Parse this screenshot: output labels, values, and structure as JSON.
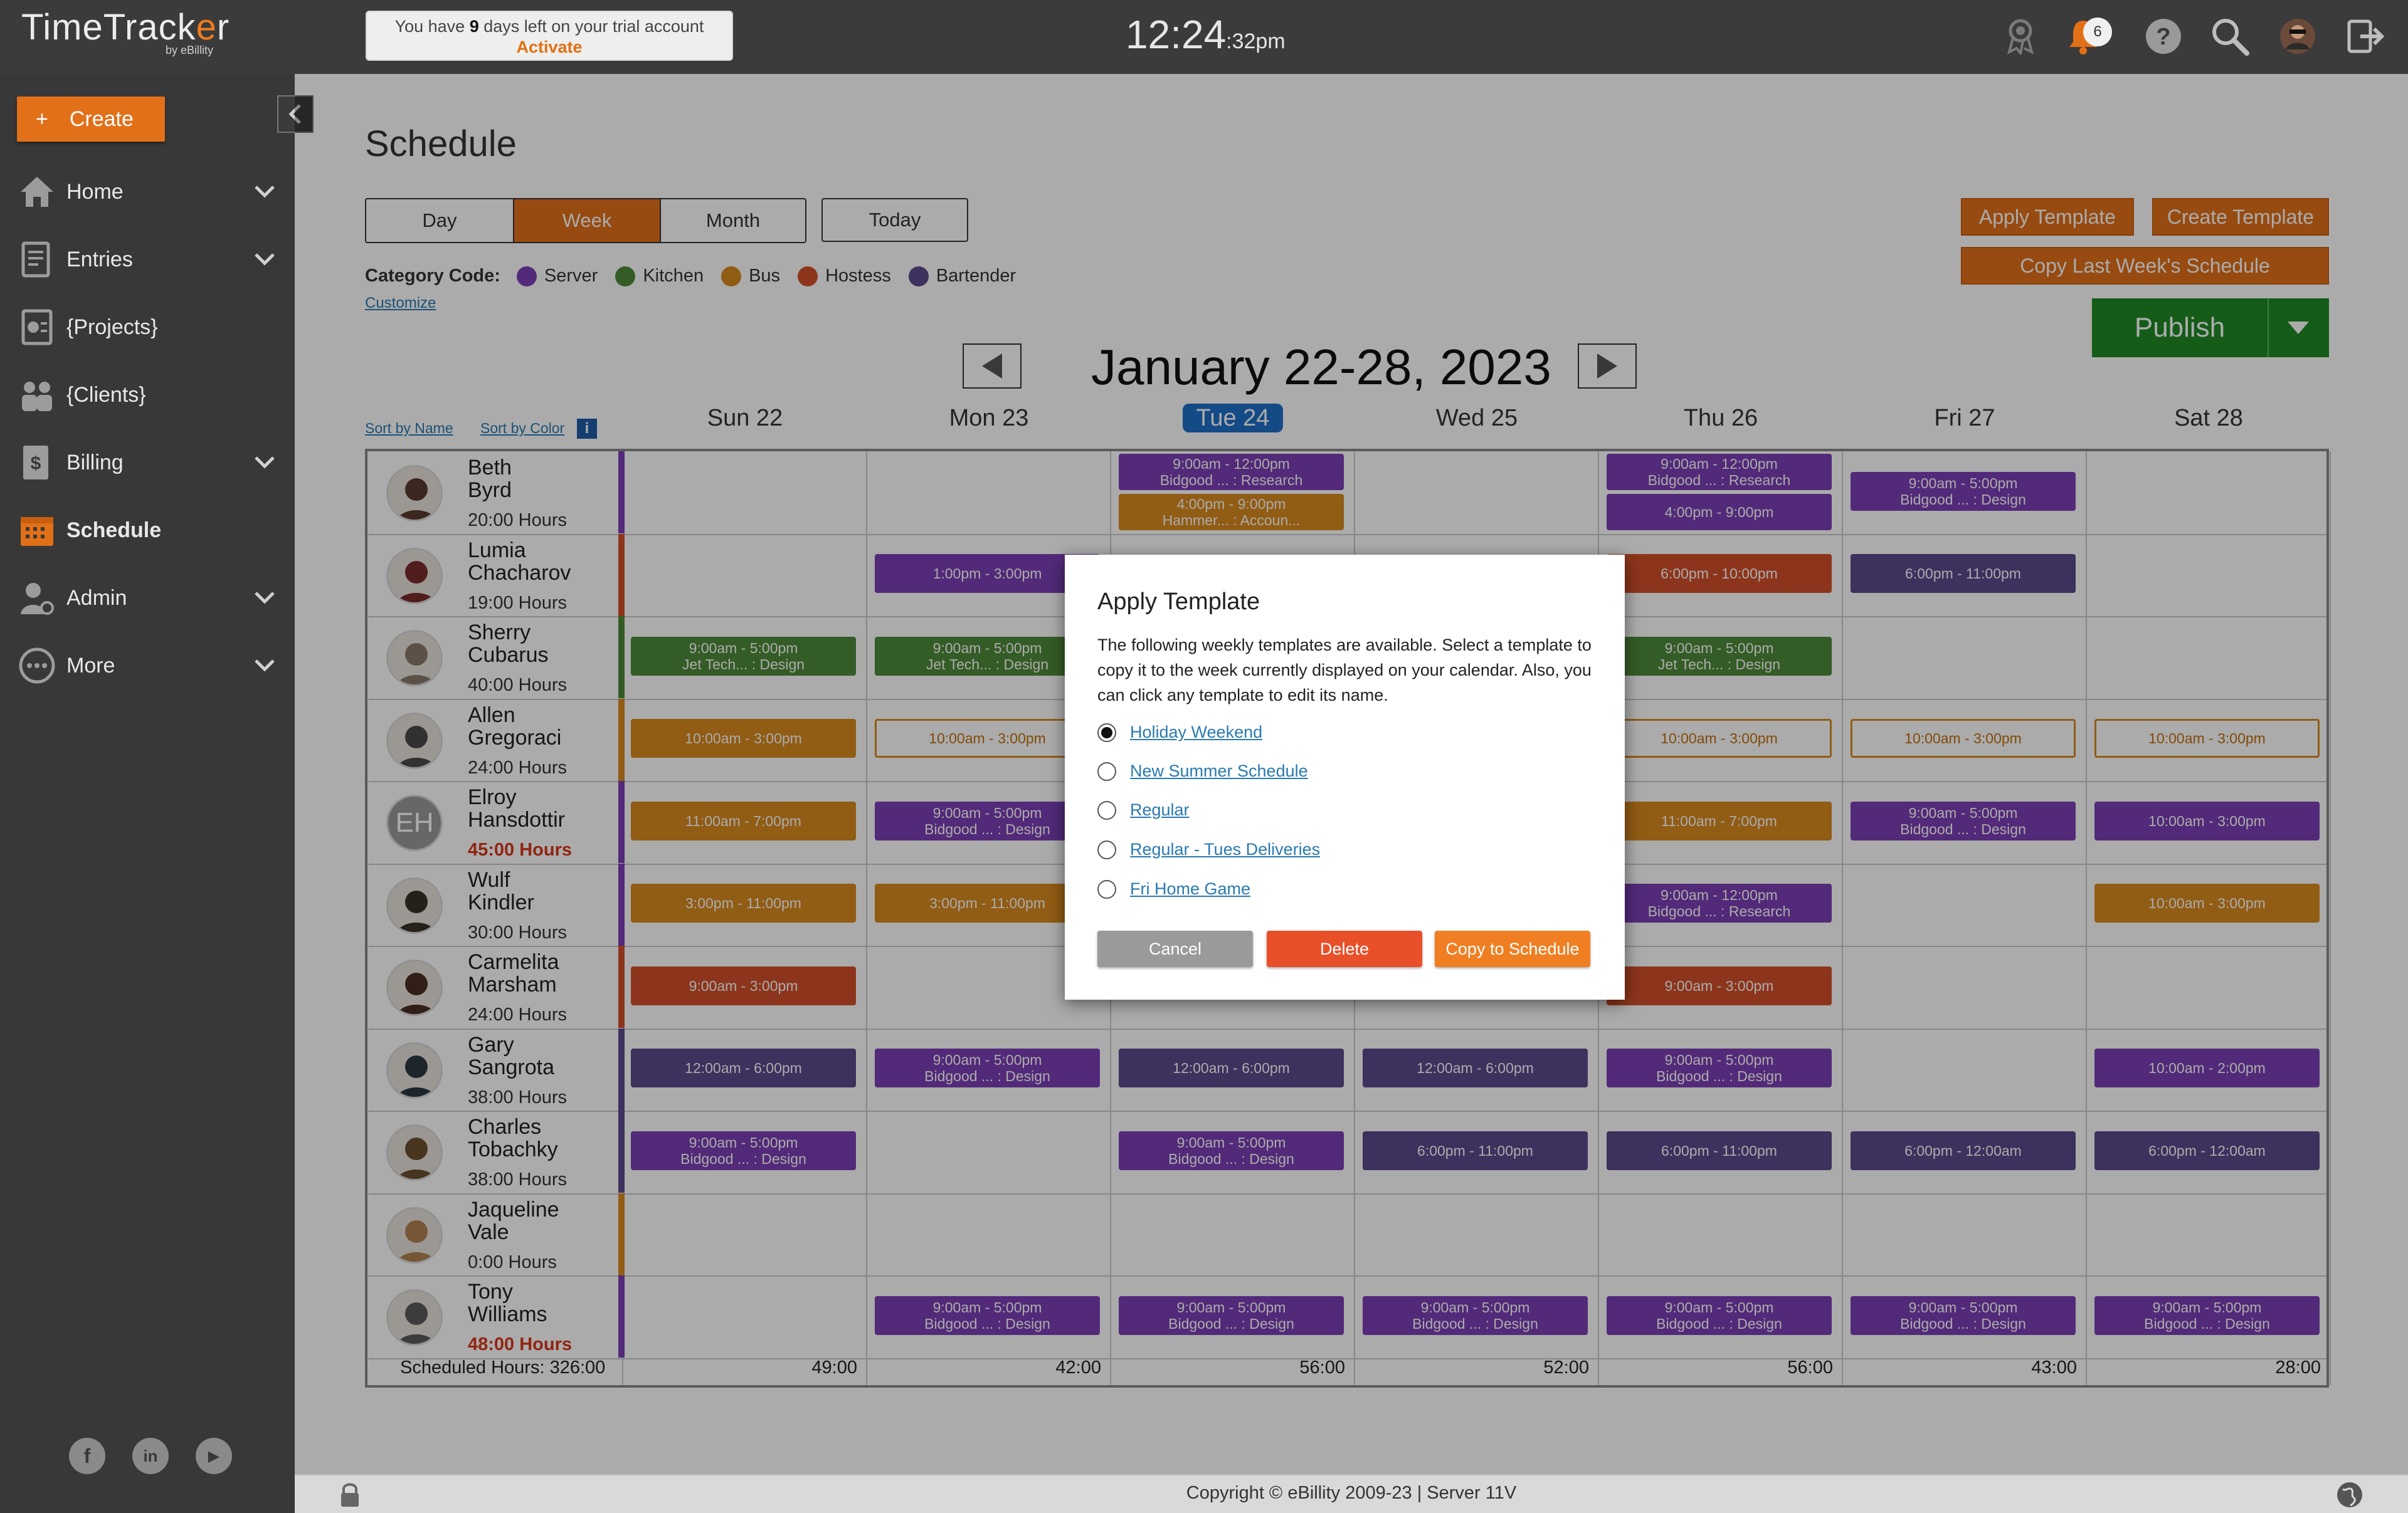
{
  "app": {
    "logo_main": "TimeTrack",
    "logo_accent": "e",
    "logo_end": "r",
    "logo_sub": "by eBillity"
  },
  "trial": {
    "text_before": "You have ",
    "days": "9",
    "text_after": " days left on your trial account",
    "action": "Activate"
  },
  "clock": {
    "time": "12:24",
    "seconds": ":32",
    "ampm": "pm"
  },
  "notifications": {
    "count": "6"
  },
  "icons": [
    "award-icon",
    "bell-icon",
    "help-icon",
    "search-icon",
    "user-avatar",
    "logout-icon"
  ],
  "sidebar": {
    "create_label": "Create",
    "items": [
      {
        "label": "Home",
        "icon": "home-icon",
        "expandable": true
      },
      {
        "label": "Entries",
        "icon": "entries-icon",
        "expandable": true
      },
      {
        "label": "{Projects}",
        "icon": "projects-icon",
        "expandable": false
      },
      {
        "label": "{Clients}",
        "icon": "clients-icon",
        "expandable": false
      },
      {
        "label": "Billing",
        "icon": "billing-icon",
        "expandable": true
      },
      {
        "label": "Schedule",
        "icon": "calendar-icon",
        "expandable": false,
        "active": true
      },
      {
        "label": "Admin",
        "icon": "admin-icon",
        "expandable": true
      },
      {
        "label": "More",
        "icon": "more-icon",
        "expandable": true
      }
    ],
    "social": [
      "f",
      "in",
      "▶"
    ]
  },
  "page": {
    "title": "Schedule"
  },
  "views": {
    "day": "Day",
    "week": "Week",
    "month": "Month",
    "today": "Today",
    "active": "Week"
  },
  "categories": {
    "label": "Category Code:",
    "customize": "Customize",
    "items": [
      {
        "name": "Server",
        "color": "#7b3fb5"
      },
      {
        "name": "Kitchen",
        "color": "#4e8a3a"
      },
      {
        "name": "Bus",
        "color": "#d88a1e"
      },
      {
        "name": "Hostess",
        "color": "#d2502a"
      },
      {
        "name": "Bartender",
        "color": "#5b4a8c"
      }
    ]
  },
  "actions": {
    "apply_template": "Apply Template",
    "create_template": "Create Template",
    "copy_last_week": "Copy Last Week's Schedule",
    "publish": "Publish"
  },
  "week": {
    "title": "January 22-28, 2023"
  },
  "sort": {
    "by_name": "Sort by Name",
    "by_color": "Sort by Color"
  },
  "days": [
    "Sun 22",
    "Mon 23",
    "Tue 24",
    "Wed 25",
    "Thu 26",
    "Fri 27",
    "Sat 28"
  ],
  "today_index": 2,
  "colors": {
    "server": "#7b3fb5",
    "kitchen": "#4e8a3a",
    "bus": "#d88a1e",
    "hostess": "#d2502a",
    "bartender": "#5b4a8c",
    "accent": "#e27018",
    "publish": "#1f8a24",
    "today": "#1e6fc8"
  },
  "employees": [
    {
      "first": "Beth",
      "last": "Byrd",
      "hours": "20:00 Hours",
      "over": false,
      "strip": "server",
      "shifts": [
        null,
        null,
        [
          [
            "9:00am - 12:00pm",
            "Bidgood ... : Research",
            "server"
          ],
          [
            "4:00pm - 9:00pm",
            "Hammer... : Accoun...",
            "bus"
          ]
        ],
        null,
        [
          [
            "9:00am - 12:00pm",
            "Bidgood ... : Research",
            "server"
          ],
          [
            "4:00pm - 9:00pm",
            "",
            "server"
          ]
        ],
        [
          [
            "9:00am - 5:00pm",
            "Bidgood ... : Design",
            "server"
          ]
        ],
        null
      ]
    },
    {
      "first": "Lumia",
      "last": "Chacharov",
      "hours": "19:00 Hours",
      "over": false,
      "strip": "hostess",
      "shifts": [
        null,
        [
          [
            "1:00pm - 3:00pm",
            "",
            "server"
          ]
        ],
        null,
        null,
        [
          [
            "6:00pm - 10:00pm",
            "",
            "hostess"
          ]
        ],
        [
          [
            "6:00pm - 11:00pm",
            "",
            "bartender"
          ]
        ],
        null
      ]
    },
    {
      "first": "Sherry",
      "last": "Cubarus",
      "hours": "40:00 Hours",
      "over": false,
      "strip": "kitchen",
      "shifts": [
        [
          [
            "9:00am - 5:00pm",
            "Jet Tech... : Design",
            "kitchen"
          ]
        ],
        [
          [
            "9:00am - 5:00pm",
            "Jet Tech... : Design",
            "kitchen"
          ]
        ],
        null,
        null,
        [
          [
            "9:00am - 5:00pm",
            "Jet Tech... : Design",
            "kitchen"
          ]
        ],
        null,
        null
      ]
    },
    {
      "first": "Allen",
      "last": "Gregoraci",
      "hours": "24:00 Hours",
      "over": false,
      "strip": "bus",
      "shifts": [
        [
          [
            "10:00am - 3:00pm",
            "",
            "bus"
          ]
        ],
        [
          [
            "10:00am - 3:00pm",
            "",
            "outline"
          ]
        ],
        null,
        null,
        [
          [
            "10:00am - 3:00pm",
            "",
            "outline"
          ]
        ],
        [
          [
            "10:00am - 3:00pm",
            "",
            "outline"
          ]
        ],
        [
          [
            "10:00am - 3:00pm",
            "",
            "outline"
          ]
        ]
      ]
    },
    {
      "first": "Elroy",
      "last": "Hansdottir",
      "hours": "45:00 Hours",
      "over": true,
      "strip": "server",
      "initials": "EH",
      "shifts": [
        [
          [
            "11:00am - 7:00pm",
            "",
            "bus"
          ]
        ],
        [
          [
            "9:00am - 5:00pm",
            "Bidgood ... : Design",
            "server"
          ]
        ],
        null,
        null,
        [
          [
            "11:00am - 7:00pm",
            "",
            "bus"
          ]
        ],
        [
          [
            "9:00am - 5:00pm",
            "Bidgood ... : Design",
            "server"
          ]
        ],
        [
          [
            "10:00am - 3:00pm",
            "",
            "server"
          ]
        ]
      ]
    },
    {
      "first": "Wulf",
      "last": "Kindler",
      "hours": "30:00 Hours",
      "over": false,
      "strip": "server",
      "shifts": [
        [
          [
            "3:00pm - 11:00pm",
            "",
            "bus"
          ]
        ],
        [
          [
            "3:00pm - 11:00pm",
            "",
            "bus"
          ]
        ],
        null,
        null,
        [
          [
            "9:00am - 12:00pm",
            "Bidgood ... : Research",
            "server"
          ]
        ],
        null,
        [
          [
            "10:00am - 3:00pm",
            "",
            "bus"
          ]
        ]
      ]
    },
    {
      "first": "Carmelita",
      "last": "Marsham",
      "hours": "24:00 Hours",
      "over": false,
      "strip": "hostess",
      "shifts": [
        [
          [
            "9:00am - 3:00pm",
            "",
            "hostess"
          ]
        ],
        null,
        null,
        null,
        [
          [
            "9:00am - 3:00pm",
            "",
            "hostess"
          ]
        ],
        null,
        null
      ]
    },
    {
      "first": "Gary",
      "last": "Sangrota",
      "hours": "38:00 Hours",
      "over": false,
      "strip": "bartender",
      "shifts": [
        [
          [
            "12:00am - 6:00pm",
            "",
            "bartender"
          ]
        ],
        [
          [
            "9:00am - 5:00pm",
            "Bidgood ... : Design",
            "server"
          ]
        ],
        [
          [
            "12:00am - 6:00pm",
            "",
            "bartender"
          ]
        ],
        [
          [
            "12:00am - 6:00pm",
            "",
            "bartender"
          ]
        ],
        [
          [
            "9:00am - 5:00pm",
            "Bidgood ... : Design",
            "server"
          ]
        ],
        null,
        [
          [
            "10:00am - 2:00pm",
            "",
            "server"
          ]
        ]
      ]
    },
    {
      "first": "Charles",
      "last": "Tobachky",
      "hours": "38:00 Hours",
      "over": false,
      "strip": "bartender",
      "shifts": [
        [
          [
            "9:00am - 5:00pm",
            "Bidgood ... : Design",
            "server"
          ]
        ],
        null,
        [
          [
            "9:00am - 5:00pm",
            "Bidgood ... : Design",
            "server"
          ]
        ],
        [
          [
            "6:00pm - 11:00pm",
            "",
            "bartender"
          ]
        ],
        [
          [
            "6:00pm - 11:00pm",
            "",
            "bartender"
          ]
        ],
        [
          [
            "6:00pm - 12:00am",
            "",
            "bartender"
          ]
        ],
        [
          [
            "6:00pm - 12:00am",
            "",
            "bartender"
          ]
        ]
      ]
    },
    {
      "first": "Jaqueline",
      "last": "Vale",
      "hours": "0:00 Hours",
      "over": false,
      "strip": "bus",
      "shifts": [
        null,
        null,
        null,
        null,
        null,
        null,
        null
      ]
    },
    {
      "first": "Tony",
      "last": "Williams",
      "hours": "48:00 Hours",
      "over": true,
      "strip": "server",
      "shifts": [
        null,
        [
          [
            "9:00am - 5:00pm",
            "Bidgood ... : Design",
            "server"
          ]
        ],
        [
          [
            "9:00am - 5:00pm",
            "Bidgood ... : Design",
            "server"
          ]
        ],
        [
          [
            "9:00am - 5:00pm",
            "Bidgood ... : Design",
            "server"
          ]
        ],
        [
          [
            "9:00am - 5:00pm",
            "Bidgood ... : Design",
            "server"
          ]
        ],
        [
          [
            "9:00am - 5:00pm",
            "Bidgood ... : Design",
            "server"
          ]
        ],
        [
          [
            "9:00am - 5:00pm",
            "Bidgood ... : Design",
            "server"
          ]
        ]
      ]
    }
  ],
  "totals": {
    "label": "Scheduled Hours: 326:00",
    "days": [
      "49:00",
      "42:00",
      "56:00",
      "52:00",
      "56:00",
      "43:00",
      "28:00"
    ]
  },
  "modal": {
    "title": "Apply Template",
    "description": "The following weekly templates are available. Select a template to copy it to the week currently displayed on your calendar. Also, you can click any template to edit its name.",
    "templates": [
      "Holiday Weekend",
      "New Summer Schedule",
      "Regular",
      "Regular - Tues Deliveries",
      "Fri Home Game"
    ],
    "selected": 0,
    "cancel": "Cancel",
    "delete": "Delete",
    "copy": "Copy to Schedule"
  },
  "footer": {
    "copyright": "Copyright © eBillity 2009-23 | Server 11V"
  }
}
